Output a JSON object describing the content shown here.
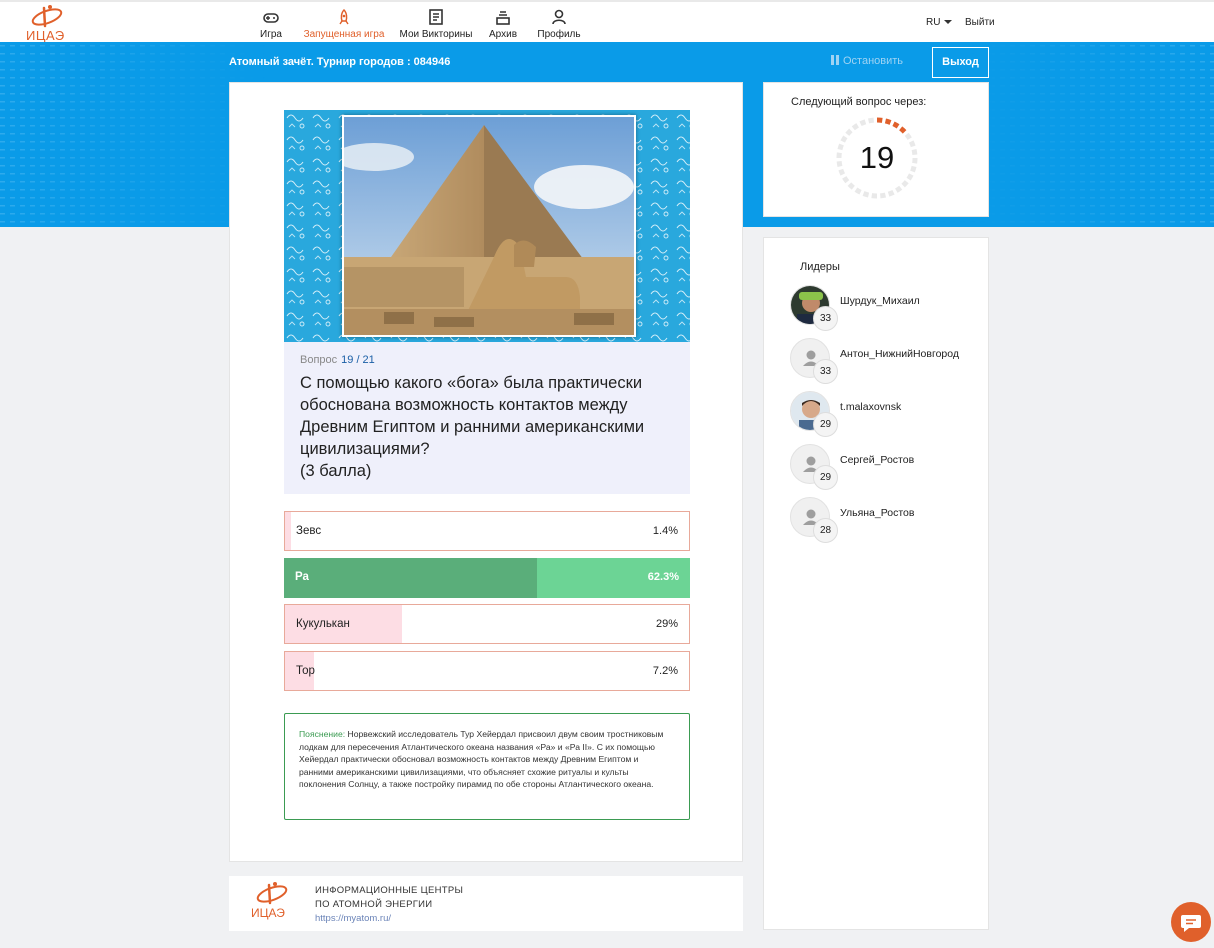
{
  "header": {
    "logo_text": "ИЦАЭ",
    "nav": [
      {
        "label": "Игра",
        "icon": "gamepad-icon",
        "active": false
      },
      {
        "label": "Запущенная игра",
        "icon": "rocket-icon",
        "active": true
      },
      {
        "label": "Мои Викторины",
        "icon": "quiz-list-icon",
        "active": false
      },
      {
        "label": "Архив",
        "icon": "archive-icon",
        "active": false
      },
      {
        "label": "Профиль",
        "icon": "user-icon",
        "active": false
      }
    ],
    "language": "RU",
    "logout": "Выйти"
  },
  "game_bar": {
    "title": "Атомный зачёт. Турнир городов : 084946",
    "stop_label": "Остановить",
    "exit_label": "Выход"
  },
  "question": {
    "prefix": "Вопрос",
    "number": "19 / 21",
    "text": "С помощью какого «бога» была практически обоснована возможность контактов между Древним Египтом и ранними американскими цивилизациями?",
    "points": "(3 балла)",
    "answers": [
      {
        "label": "Зевс",
        "percent": "1.4%",
        "share": 0.014,
        "correct": false
      },
      {
        "label": "Ра",
        "percent": "62.3%",
        "share": 0.623,
        "correct": true
      },
      {
        "label": "Кукулькан",
        "percent": "29%",
        "share": 0.29,
        "correct": false
      },
      {
        "label": "Тор",
        "percent": "7.2%",
        "share": 0.072,
        "correct": false
      }
    ],
    "explanation_head": "Пояснение:",
    "explanation_text": "Норвежский исследователь Тур Хейердал присвоил двум своим тростниковым лодкам для пересечения Атлантического океана названия «Ра» и «Ра II». С их помощью Хейердал практически обосновал возможность контактов между Древним Египтом и ранними американскими цивилизациями, что объясняет схожие ритуалы и культы поклонения Солнцу, а также постройку пирамид по обе стороны Атлантического океана."
  },
  "timer": {
    "label": "Следующий вопрос через:",
    "seconds": "19",
    "remaining_fraction": 0.16
  },
  "leaders": {
    "label": "Лидеры",
    "items": [
      {
        "name": "Шурдук_Михаил",
        "score": "33",
        "avatar": "photo"
      },
      {
        "name": "Антон_НижнийНовгород",
        "score": "33",
        "avatar": "placeholder"
      },
      {
        "name": "t.malaxovnsk",
        "score": "29",
        "avatar": "photo"
      },
      {
        "name": "Сергей_Ростов",
        "score": "29",
        "avatar": "placeholder"
      },
      {
        "name": "Ульяна_Ростов",
        "score": "28",
        "avatar": "placeholder"
      }
    ]
  },
  "footer": {
    "logo_text": "ИЦАЭ",
    "line1": "ИНФОРМАЦИОННЫЕ ЦЕНТРЫ",
    "line2": "ПО АТОМНОЙ ЭНЕРГИИ",
    "link": "https://myatom.ru/"
  },
  "colors": {
    "accent": "#e0602b",
    "banner": "#0a9be8",
    "correct_fill": "#5aae7a",
    "correct_bg": "#6cd495",
    "wrong_fill": "#fddde4",
    "wrong_border": "#e8a99a",
    "explanation_border": "#3b9b52"
  }
}
